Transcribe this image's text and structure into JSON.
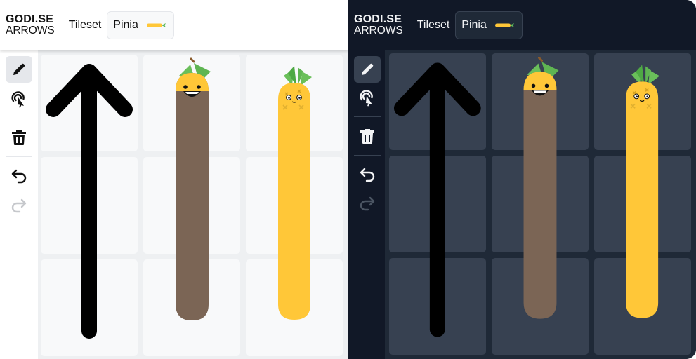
{
  "app": {
    "logo_line1": "GODI.SE",
    "logo_line2": "ARROWS"
  },
  "header": {
    "tileset_label": "Tileset",
    "tileset_value": "Pinia"
  },
  "toolbar": {
    "tools": [
      "pencil-icon",
      "touch-draw-icon",
      "trash-icon",
      "undo-icon",
      "redo-icon"
    ],
    "active_tool": "pencil-icon",
    "redo_enabled": false
  },
  "board": {
    "rows": 3,
    "cols": 3,
    "arrows": [
      {
        "column": 1,
        "type": "arrow",
        "direction": "up",
        "color": "#000000"
      },
      {
        "column": 2,
        "type": "pineapple-snake",
        "expression": "happy",
        "color": "#7b6555"
      },
      {
        "column": 3,
        "type": "pineapple-snake",
        "expression": "dead",
        "color": "#ffc738"
      }
    ]
  },
  "themes": {
    "light": {
      "background": "#ffffff",
      "board": "#eef0f2",
      "cell": "#f8f9fa"
    },
    "dark": {
      "background": "#111827",
      "board": "#1f2937",
      "cell": "#374151"
    }
  }
}
